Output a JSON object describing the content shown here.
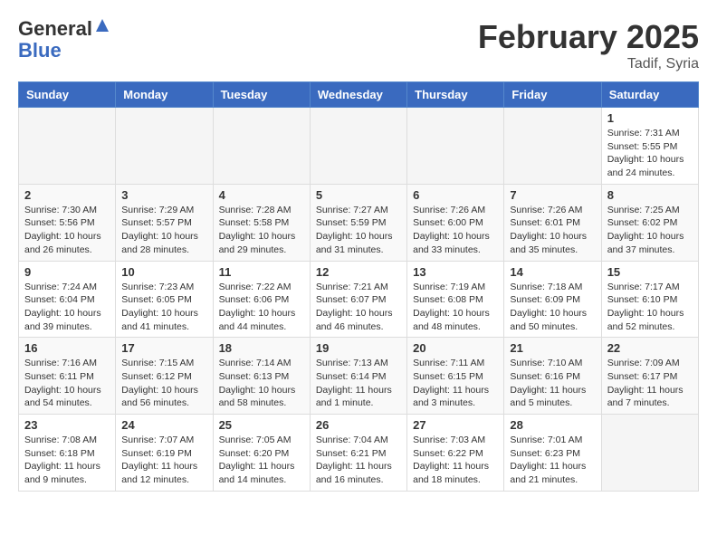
{
  "header": {
    "logo_general": "General",
    "logo_blue": "Blue",
    "month_year": "February 2025",
    "location": "Tadif, Syria"
  },
  "weekdays": [
    "Sunday",
    "Monday",
    "Tuesday",
    "Wednesday",
    "Thursday",
    "Friday",
    "Saturday"
  ],
  "weeks": [
    [
      {
        "day": "",
        "info": ""
      },
      {
        "day": "",
        "info": ""
      },
      {
        "day": "",
        "info": ""
      },
      {
        "day": "",
        "info": ""
      },
      {
        "day": "",
        "info": ""
      },
      {
        "day": "",
        "info": ""
      },
      {
        "day": "1",
        "info": "Sunrise: 7:31 AM\nSunset: 5:55 PM\nDaylight: 10 hours and 24 minutes."
      }
    ],
    [
      {
        "day": "2",
        "info": "Sunrise: 7:30 AM\nSunset: 5:56 PM\nDaylight: 10 hours and 26 minutes."
      },
      {
        "day": "3",
        "info": "Sunrise: 7:29 AM\nSunset: 5:57 PM\nDaylight: 10 hours and 28 minutes."
      },
      {
        "day": "4",
        "info": "Sunrise: 7:28 AM\nSunset: 5:58 PM\nDaylight: 10 hours and 29 minutes."
      },
      {
        "day": "5",
        "info": "Sunrise: 7:27 AM\nSunset: 5:59 PM\nDaylight: 10 hours and 31 minutes."
      },
      {
        "day": "6",
        "info": "Sunrise: 7:26 AM\nSunset: 6:00 PM\nDaylight: 10 hours and 33 minutes."
      },
      {
        "day": "7",
        "info": "Sunrise: 7:26 AM\nSunset: 6:01 PM\nDaylight: 10 hours and 35 minutes."
      },
      {
        "day": "8",
        "info": "Sunrise: 7:25 AM\nSunset: 6:02 PM\nDaylight: 10 hours and 37 minutes."
      }
    ],
    [
      {
        "day": "9",
        "info": "Sunrise: 7:24 AM\nSunset: 6:04 PM\nDaylight: 10 hours and 39 minutes."
      },
      {
        "day": "10",
        "info": "Sunrise: 7:23 AM\nSunset: 6:05 PM\nDaylight: 10 hours and 41 minutes."
      },
      {
        "day": "11",
        "info": "Sunrise: 7:22 AM\nSunset: 6:06 PM\nDaylight: 10 hours and 44 minutes."
      },
      {
        "day": "12",
        "info": "Sunrise: 7:21 AM\nSunset: 6:07 PM\nDaylight: 10 hours and 46 minutes."
      },
      {
        "day": "13",
        "info": "Sunrise: 7:19 AM\nSunset: 6:08 PM\nDaylight: 10 hours and 48 minutes."
      },
      {
        "day": "14",
        "info": "Sunrise: 7:18 AM\nSunset: 6:09 PM\nDaylight: 10 hours and 50 minutes."
      },
      {
        "day": "15",
        "info": "Sunrise: 7:17 AM\nSunset: 6:10 PM\nDaylight: 10 hours and 52 minutes."
      }
    ],
    [
      {
        "day": "16",
        "info": "Sunrise: 7:16 AM\nSunset: 6:11 PM\nDaylight: 10 hours and 54 minutes."
      },
      {
        "day": "17",
        "info": "Sunrise: 7:15 AM\nSunset: 6:12 PM\nDaylight: 10 hours and 56 minutes."
      },
      {
        "day": "18",
        "info": "Sunrise: 7:14 AM\nSunset: 6:13 PM\nDaylight: 10 hours and 58 minutes."
      },
      {
        "day": "19",
        "info": "Sunrise: 7:13 AM\nSunset: 6:14 PM\nDaylight: 11 hours and 1 minute."
      },
      {
        "day": "20",
        "info": "Sunrise: 7:11 AM\nSunset: 6:15 PM\nDaylight: 11 hours and 3 minutes."
      },
      {
        "day": "21",
        "info": "Sunrise: 7:10 AM\nSunset: 6:16 PM\nDaylight: 11 hours and 5 minutes."
      },
      {
        "day": "22",
        "info": "Sunrise: 7:09 AM\nSunset: 6:17 PM\nDaylight: 11 hours and 7 minutes."
      }
    ],
    [
      {
        "day": "23",
        "info": "Sunrise: 7:08 AM\nSunset: 6:18 PM\nDaylight: 11 hours and 9 minutes."
      },
      {
        "day": "24",
        "info": "Sunrise: 7:07 AM\nSunset: 6:19 PM\nDaylight: 11 hours and 12 minutes."
      },
      {
        "day": "25",
        "info": "Sunrise: 7:05 AM\nSunset: 6:20 PM\nDaylight: 11 hours and 14 minutes."
      },
      {
        "day": "26",
        "info": "Sunrise: 7:04 AM\nSunset: 6:21 PM\nDaylight: 11 hours and 16 minutes."
      },
      {
        "day": "27",
        "info": "Sunrise: 7:03 AM\nSunset: 6:22 PM\nDaylight: 11 hours and 18 minutes."
      },
      {
        "day": "28",
        "info": "Sunrise: 7:01 AM\nSunset: 6:23 PM\nDaylight: 11 hours and 21 minutes."
      },
      {
        "day": "",
        "info": ""
      }
    ]
  ]
}
